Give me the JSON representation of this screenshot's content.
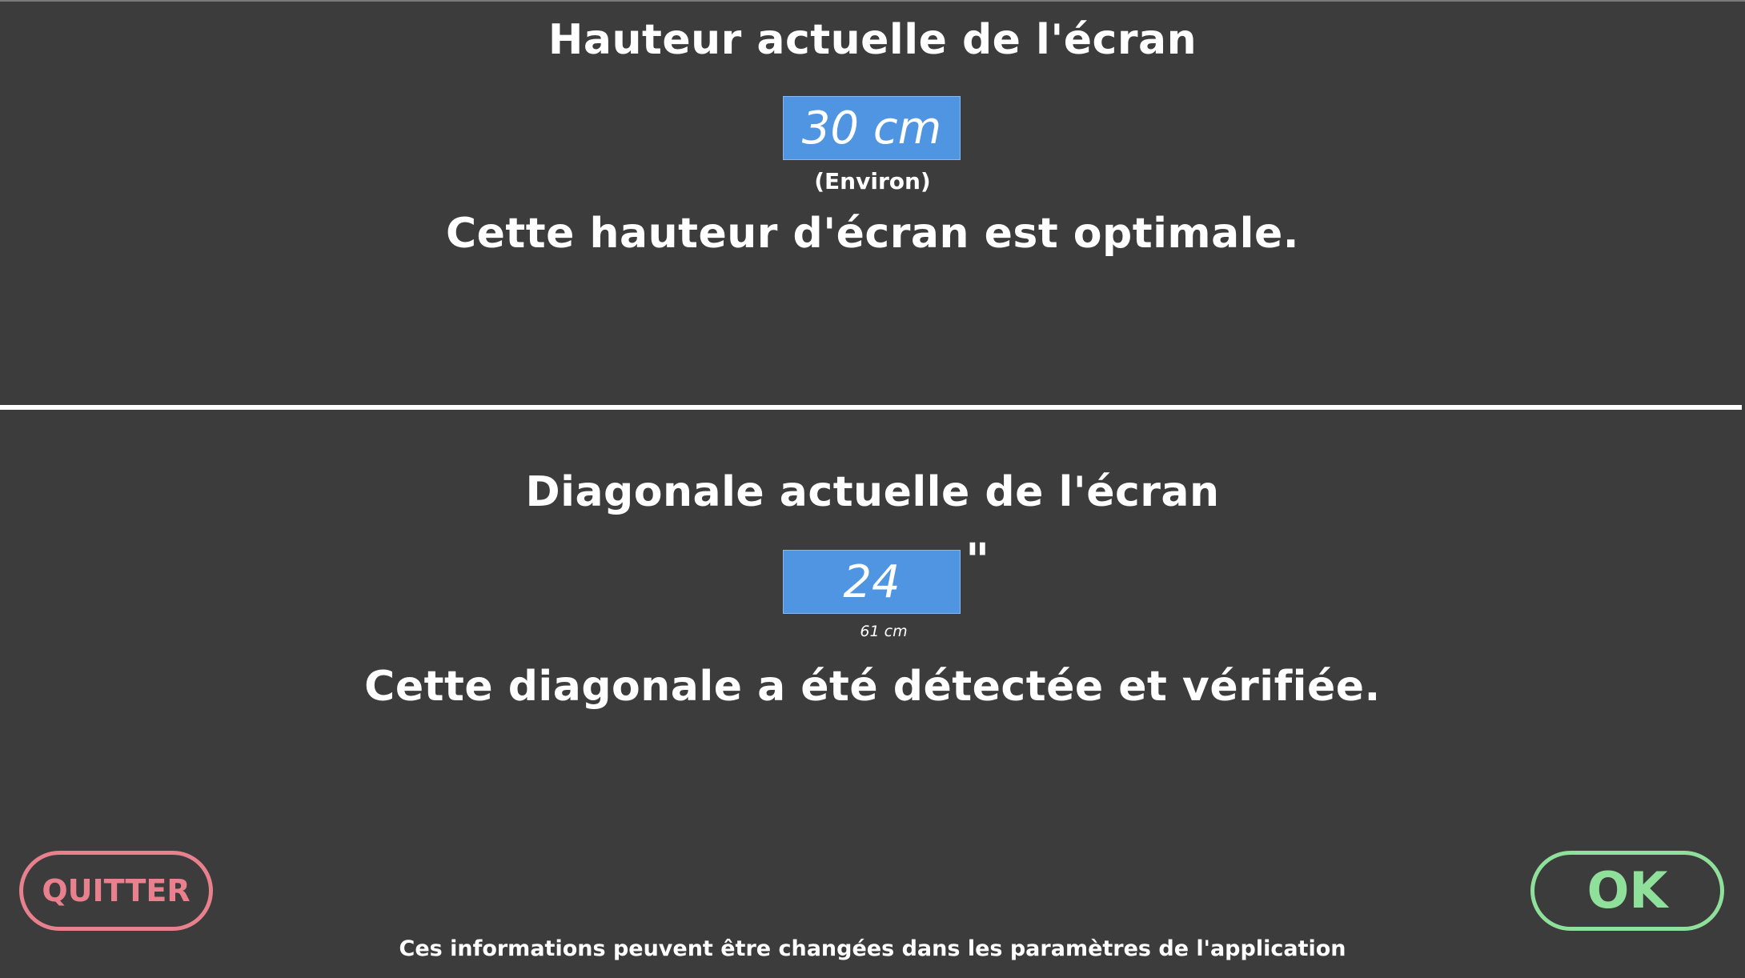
{
  "height_section": {
    "title": "Hauteur actuelle de l'écran",
    "value": "30 cm",
    "note": "(Environ)",
    "status": "Cette hauteur d'écran est optimale."
  },
  "diagonal_section": {
    "title": "Diagonale actuelle de l'écran",
    "value": "24",
    "unit": "\"",
    "metric": "61 cm",
    "status": "Cette diagonale a été détectée et vérifiée."
  },
  "buttons": {
    "quit_label": "QUITTER",
    "ok_label": "OK"
  },
  "footer": {
    "text": "Ces informations peuvent être changées dans les paramètres de l'application"
  },
  "colors": {
    "background": "#3c3c3c",
    "value_box": "#4f95e2",
    "quit": "#e8808e",
    "ok": "#8fe09a"
  }
}
